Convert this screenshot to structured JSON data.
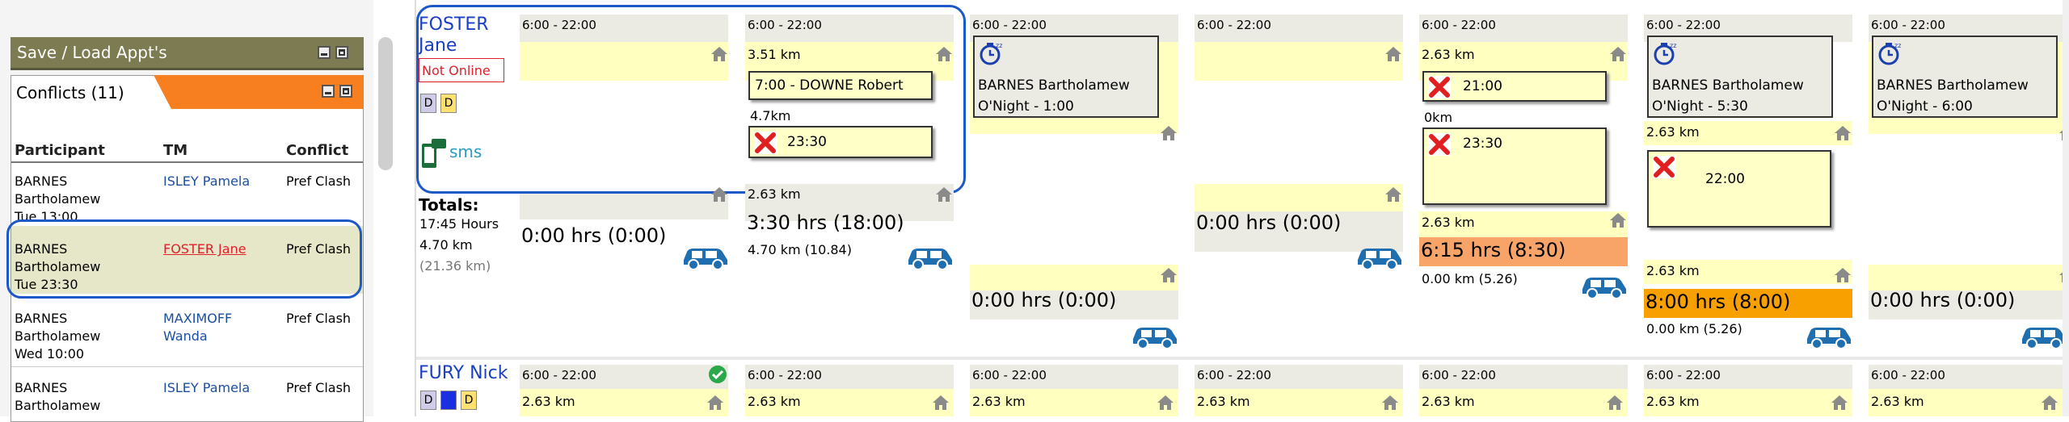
{
  "save_load_panel": {
    "title": "Save / Load Appt's"
  },
  "conflicts": {
    "title": "Conflicts (11)",
    "columns": [
      "Participant",
      "TM",
      "Conflict"
    ],
    "rows": [
      {
        "participant": [
          "BARNES",
          "Bartholamew",
          "Tue 13:00"
        ],
        "tm": "ISLEY Pamela",
        "conflict": "Pref Clash"
      },
      {
        "participant": [
          "BARNES",
          "Bartholamew",
          "Tue 23:30"
        ],
        "tm": "FOSTER Jane",
        "conflict": "Pref Clash"
      },
      {
        "participant": [
          "BARNES",
          "Bartholamew",
          "Wed 10:00"
        ],
        "tm": [
          "MAXIMOFF",
          "Wanda"
        ],
        "conflict": "Pref Clash"
      },
      {
        "participant": [
          "BARNES",
          "Bartholamew"
        ],
        "tm": "ISLEY Pamela",
        "conflict": "Pref Clash"
      }
    ]
  },
  "worker1": {
    "name_line1": "FOSTER",
    "name_line2": "Jane",
    "status": "Not Online",
    "badges": [
      "D",
      "D"
    ],
    "sms_label": "sms",
    "totals_label": "Totals:",
    "totals_hours": "17:45 Hours",
    "totals_km": "4.70 km",
    "totals_km_alt": "(21.36 km)",
    "days": [
      {
        "shift": "6:00 - 22:00",
        "hours": "0:00 hrs (0:00)"
      },
      {
        "shift": "6:00 - 22:00",
        "km_top": "3.51 km",
        "appt1": "7:00 - DOWNE Robert",
        "between_km": "4.7km",
        "appt2": "23:30",
        "km_bottom": "2.63 km",
        "hours": "3:30 hrs (18:00)",
        "sub": "4.70 km (10.84)"
      },
      {
        "shift": "6:00 - 22:00",
        "overnight_name": "BARNES Bartholamew",
        "overnight_time": "O'Night - 1:00",
        "hours": "0:00 hrs (0:00)"
      },
      {
        "shift": "6:00 - 22:00",
        "hours": "0:00 hrs (0:00)"
      },
      {
        "shift": "6:00 - 22:00",
        "km_top": "2.63 km",
        "appt1": "21:00",
        "between_km": "0km",
        "appt2": "23:30",
        "km_bottom": "2.63 km",
        "hours": "6:15 hrs (8:30)",
        "sub": "0.00 km (5.26)"
      },
      {
        "shift": "6:00 - 22:00",
        "overnight_name": "BARNES Bartholamew",
        "overnight_time": "O'Night - 5:30",
        "km_top": "2.63 km",
        "appt1": "22:00",
        "km_bottom": "2.63 km",
        "hours": "8:00 hrs (8:00)",
        "sub": "0.00 km (5.26)"
      },
      {
        "shift": "6:00 - 22:00",
        "overnight_name": "BARNES Bartholamew",
        "overnight_time": "O'Night - 6:00",
        "hours": "0:00 hrs (0:00)"
      }
    ]
  },
  "worker2": {
    "name": "FURY Nick",
    "badges": [
      "D",
      "D",
      "D"
    ],
    "days": [
      {
        "shift": "6:00 - 22:00",
        "km": "2.63 km"
      },
      {
        "shift": "6:00 - 22:00",
        "km": "2.63 km"
      },
      {
        "shift": "6:00 - 22:00",
        "km": "2.63 km"
      },
      {
        "shift": "6:00 - 22:00",
        "km": "2.63 km"
      },
      {
        "shift": "6:00 - 22:00",
        "km": "2.63 km"
      },
      {
        "shift": "6:00 - 22:00",
        "km": "2.63 km"
      },
      {
        "shift": "6:00 - 22:00",
        "km": "2.63 km"
      }
    ]
  },
  "colors": {
    "accent_blue": "#1c58c8",
    "shift_yellow": "#ffffc0",
    "cell_gray": "#ebebe4",
    "overtime_orange": "#f8a468",
    "full_orange": "#f8a000",
    "car_blue": "#1f6fb0",
    "not_online_red": "#e0202a"
  },
  "icons": [
    "house-icon",
    "car-icon",
    "cross-icon",
    "overnight-clock-icon",
    "check-icon",
    "phone-sms-icon"
  ]
}
